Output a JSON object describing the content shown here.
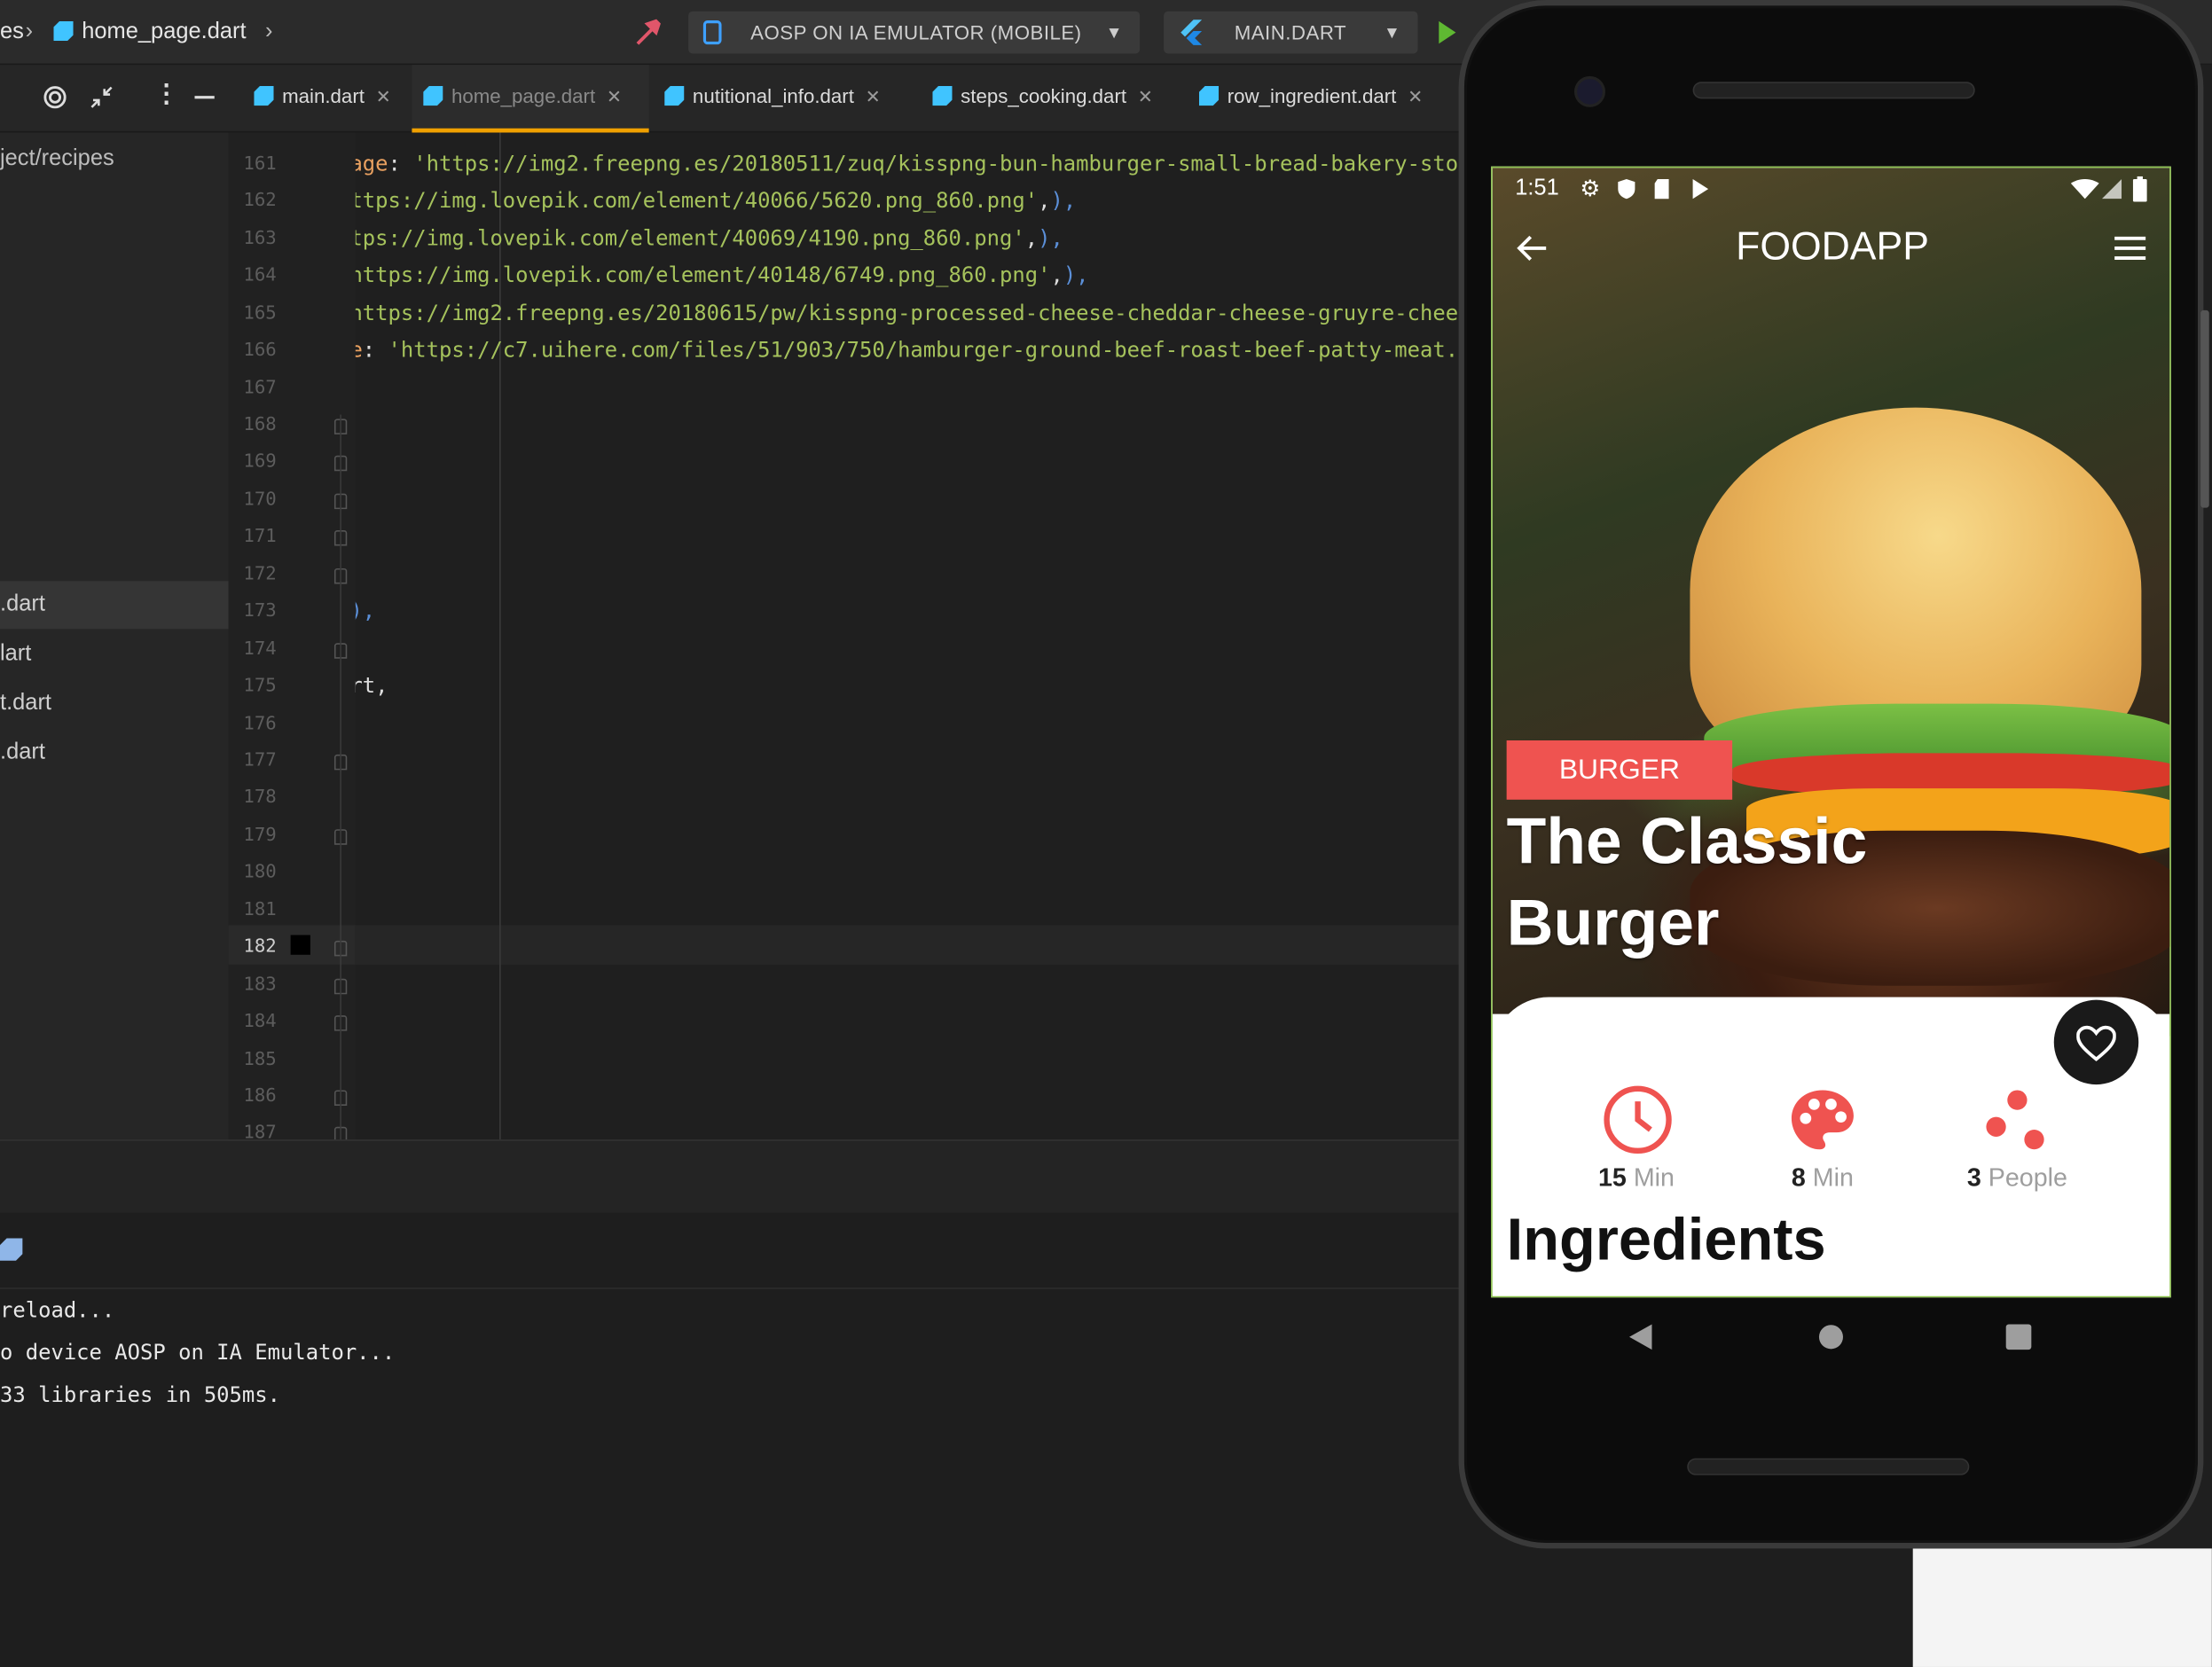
{
  "ide": {
    "breadcrumb": {
      "left": "es",
      "file": "home_page.dart"
    },
    "device_selector": "AOSP ON IA EMULATOR (MOBILE)",
    "config_selector": "MAIN.DART",
    "tabs": [
      {
        "label": "main.dart"
      },
      {
        "label": "home_page.dart"
      },
      {
        "label": "nutitional_info.dart"
      },
      {
        "label": "steps_cooking.dart"
      },
      {
        "label": "row_ingredient.dart"
      }
    ],
    "project": {
      "path": "ject/recipes",
      "files": [
        ".dart",
        "lart",
        "t.dart",
        ".dart"
      ]
    },
    "lines": [
      "161",
      "162",
      "163",
      "164",
      "165",
      "166",
      "167",
      "168",
      "169",
      "170",
      "171",
      "172",
      "173",
      "174",
      "175",
      "176",
      "177",
      "178",
      "179",
      "180",
      "181",
      "182",
      "183",
      "184",
      "185",
      "186",
      "187"
    ],
    "code": {
      "l161_key": "age",
      "l161_val": "'https://img2.freepng.es/20180511/zuq/kisspng-bun-hamburger-small-bread-bakery-stock",
      "l162": "ttps://img.lovepik.com/element/40066/5620.png_860.png'",
      "l163": "tps://img.lovepik.com/element/40069/4190.png_860.png'",
      "l164": "https://img.lovepik.com/element/40148/6749.png_860.png'",
      "l165": "https://img2.freepng.es/20180615/pw/kisspng-processed-cheese-cheddar-cheese-gruyre-cheese-",
      "l166_key": "e",
      "l166_val": "'https://c7.uihere.com/files/51/903/750/hamburger-ground-beef-roast-beef-patty-meat.jpg",
      "l173": "),",
      "l175": "rt,"
    },
    "console": [
      "reload...",
      "o device AOSP on IA Emulator...",
      "33 libraries in 505ms."
    ]
  },
  "phone": {
    "status_time": "1:51",
    "app_title": "FOODAPP",
    "category": "BURGER",
    "dish_title": "The Classic Burger",
    "stats": [
      {
        "value": "15",
        "unit": "Min",
        "icon": "clock-icon"
      },
      {
        "value": "8",
        "unit": "Min",
        "icon": "palette-icon"
      },
      {
        "value": "3",
        "unit": "People",
        "icon": "dots-icon"
      }
    ],
    "section_title": "Ingredients"
  },
  "colors": {
    "accent": "#ef5350",
    "editor_bg": "#1f1f1f",
    "string_green": "#a5c25c",
    "tab_active": "#f0a000"
  }
}
